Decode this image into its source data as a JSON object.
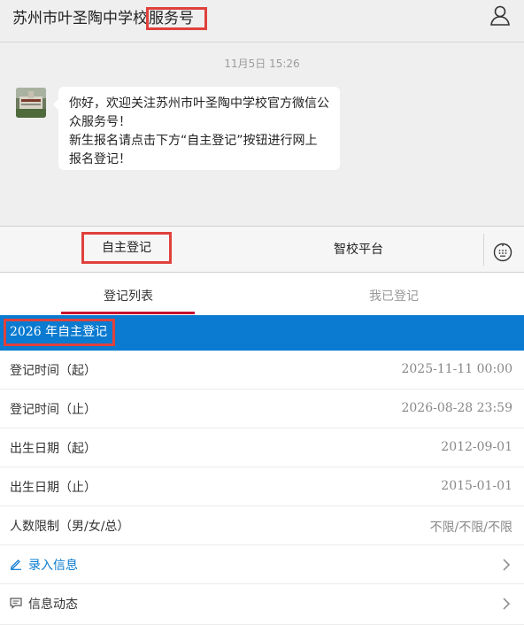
{
  "header": {
    "title_main": "苏州市叶圣陶中学校",
    "title_highlight": "服务号"
  },
  "chat": {
    "timestamp": "11月5日 15:26",
    "message_line1": "你好，欢迎关注苏州市叶圣陶中学校官方微信公",
    "message_line2": "众服务号！",
    "message_line3": "新生报名请点击下方“自主登记”按钮进行网上",
    "message_line4": "报名登记！"
  },
  "menu": {
    "left_label": "自主登记",
    "mid_label": "智校平台"
  },
  "tabs": {
    "tab1": "登记列表",
    "tab2": "我已登记"
  },
  "section": {
    "title": "2026 年自主登记"
  },
  "rows": [
    {
      "label": "登记时间（起）",
      "value": "2025-11-11 00:00"
    },
    {
      "label": "登记时间（止）",
      "value": "2026-08-28 23:59"
    },
    {
      "label": "出生日期（起）",
      "value": "2012-09-01"
    },
    {
      "label": "出生日期（止）",
      "value": "2015-01-01"
    },
    {
      "label": "人数限制（男/女/总）",
      "value": "不限/不限/不限"
    }
  ],
  "actions": {
    "enter_info": "录入信息",
    "news": "信息动态"
  },
  "colors": {
    "accent_blue": "#0a7bd0",
    "tab_red": "#c8102e",
    "highlight_red": "#e0413c"
  }
}
